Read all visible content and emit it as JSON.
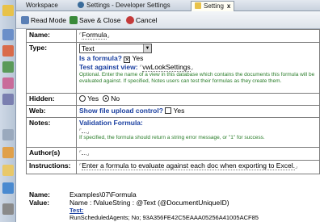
{
  "tabs": [
    {
      "label": "Workspace"
    },
    {
      "label": "Settings - Developer Settings"
    },
    {
      "label": "Setting",
      "close": "x"
    }
  ],
  "toolbar": {
    "read_mode": "Read Mode",
    "save_close": "Save & Close",
    "cancel": "Cancel"
  },
  "form": {
    "name": {
      "label": "Name:",
      "value": "Formula"
    },
    "type": {
      "label": "Type:",
      "selected": "Text",
      "is_formula_label": "Is a formula?",
      "is_formula_value": "Yes",
      "test_view_label": "Test against view:",
      "test_view_value": "vwLookSettings",
      "help": "Optional. Enter the name of a view in this database which contains the documents this formula will be evaluated against. If specified, Notes users can test their formulas as they create them."
    },
    "hidden": {
      "label": "Hidden:",
      "yes": "Yes",
      "no": "No"
    },
    "web": {
      "label": "Web:",
      "upload_label": "Show file upload control?",
      "upload_value": "Yes"
    },
    "notes": {
      "label": "Notes:",
      "validation_label": "Validation Formula:",
      "help": "If specified, the formula should return a string error message, or \"1\" for success."
    },
    "authors": {
      "label": "Author(s)"
    },
    "instructions": {
      "label": "Instructions:",
      "value": "Enter a formula to evaluate against each doc when exporting to Excel."
    }
  },
  "props": {
    "name_label": "Name:",
    "name_value": "Examples\\07\\Formula",
    "value_label": "Value:",
    "value_line1": "Name : fValueString : @Text (@DocumentUniqueID)",
    "value_line2": "Test:",
    "value_line3": "RunScheduledAgents; No; 93A356FE42C5EAAA05256A41005ACF85"
  },
  "colors": {
    "accent": "#1a3fa0",
    "help_text": "#2a7d2a",
    "sidebar": "#cfd9e6"
  }
}
